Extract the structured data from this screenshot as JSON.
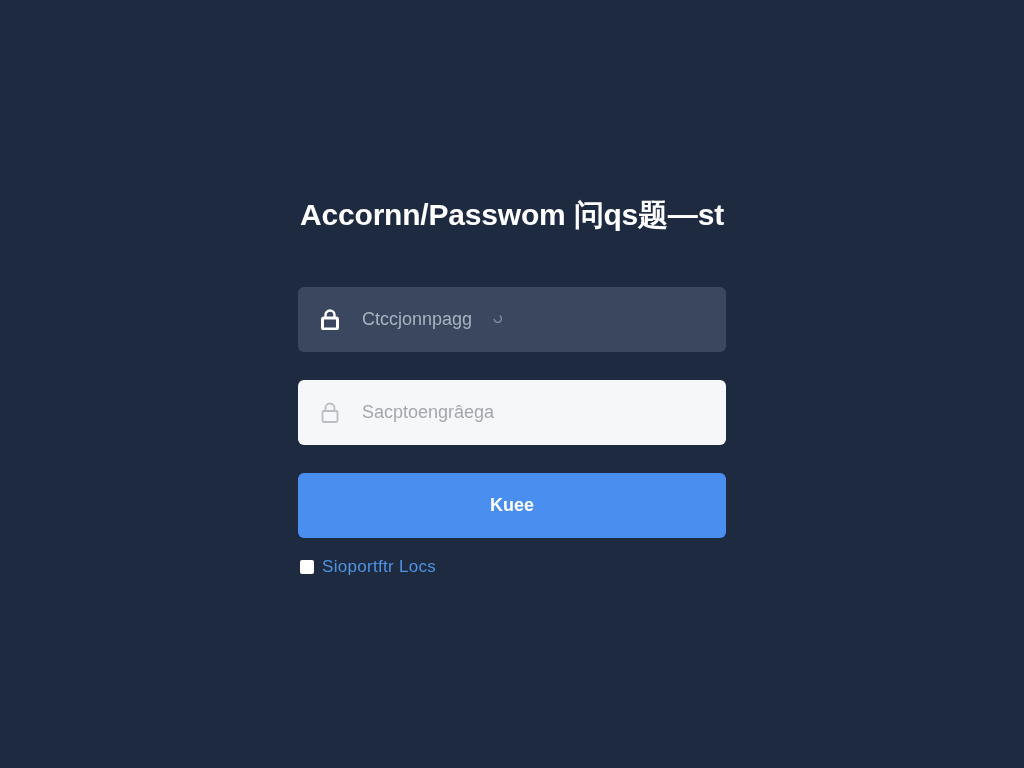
{
  "title": "Accornn/Passwom 问qs题—st",
  "fields": [
    {
      "kind": "dark",
      "placeholder": "Ctccjonnpagg"
    },
    {
      "kind": "light",
      "placeholder": "Sacptoengrâega"
    }
  ],
  "submit_button": {
    "label": "Kuee"
  },
  "checkbox": {
    "label": "Sioportftr Locs",
    "checked": false
  }
}
